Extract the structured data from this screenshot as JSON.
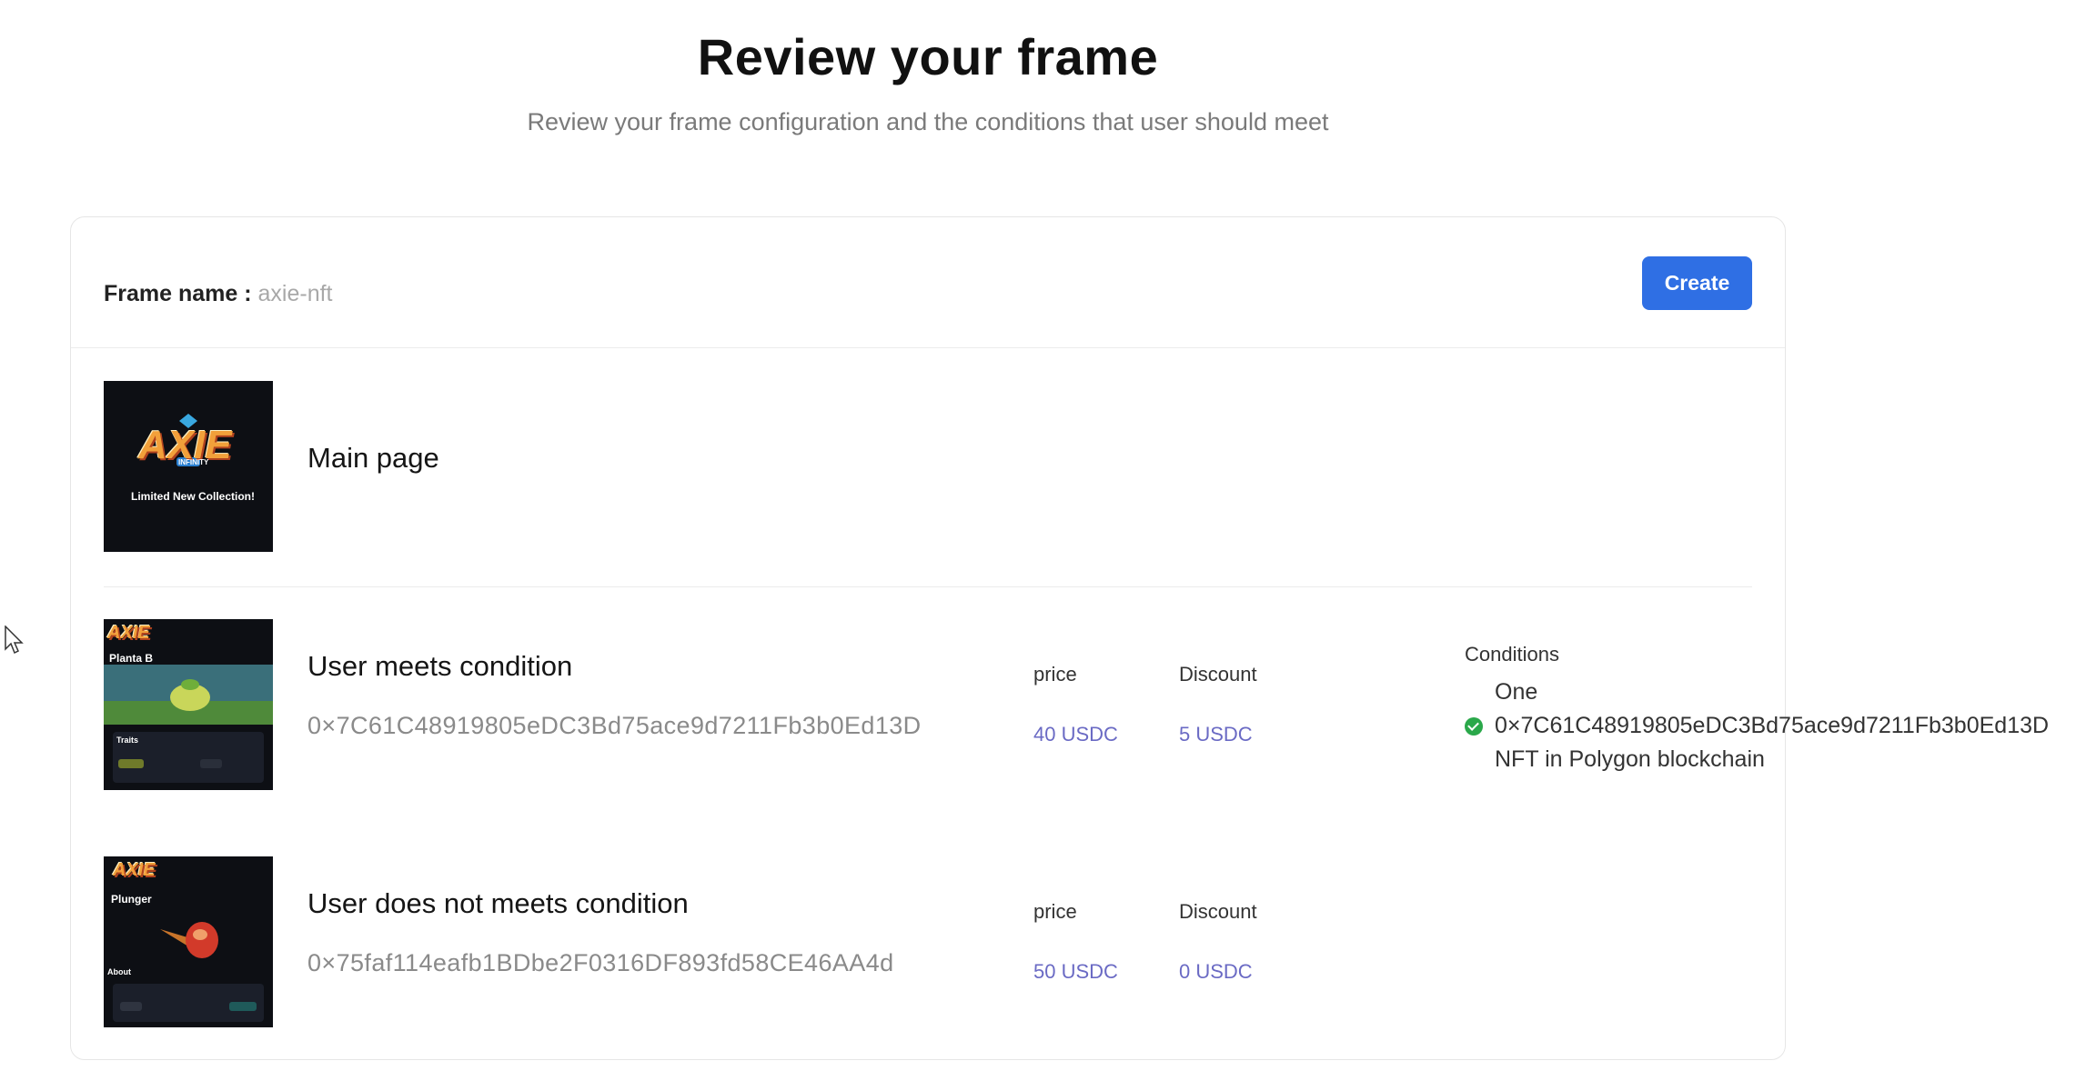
{
  "header": {
    "title": "Review your frame",
    "subtitle": "Review your frame configuration and the conditions that user should meet"
  },
  "frame": {
    "name_label": "Frame name :",
    "name_value": "axie-nft",
    "create_label": "Create"
  },
  "pages": [
    {
      "title": "Main page",
      "thumb_logo": "AXIE",
      "thumb_logo_sub": "INFINITY",
      "thumb_caption": "Limited New Collection!"
    },
    {
      "title": "User meets condition",
      "address": "0×7C61C48919805eDC3Bd75ace9d7211Fb3b0Ed13D",
      "price_label": "price",
      "price_value": "40 USDC",
      "discount_label": "Discount",
      "discount_value": "5 USDC",
      "thumb_logo": "AXIE",
      "thumb_name": "Planta B",
      "thumb_section": "Traits",
      "conditions": {
        "title": "Conditions",
        "line1": "One",
        "line2": "0×7C61C48919805eDC3Bd75ace9d7211Fb3b0Ed13D",
        "line3": "NFT in Polygon blockchain",
        "status_color": "#2aa84a"
      }
    },
    {
      "title": "User does not meets condition",
      "address": "0×75faf114eafb1BDbe2F0316DF893fd58CE46AA4d",
      "price_label": "price",
      "price_value": "50 USDC",
      "discount_label": "Discount",
      "discount_value": "0 USDC",
      "thumb_logo": "AXIE",
      "thumb_name": "Plunger",
      "thumb_section": "About"
    }
  ],
  "colors": {
    "accent": "#2f6fe4",
    "value_text": "#6a6ac4",
    "muted_text": "#8a8a8a"
  }
}
